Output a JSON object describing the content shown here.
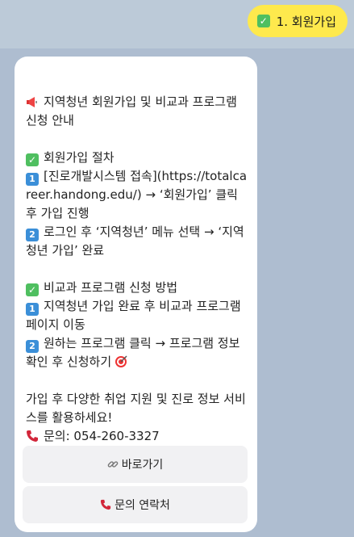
{
  "user_message": {
    "text": "1. 회원가입",
    "icon": "check-icon"
  },
  "bot_message": {
    "title": "지역청년 회원가입 및 비교과 프로그램 신청 안내",
    "signup_heading": "회원가입 절차",
    "signup_step_1": "[진로개발시스템 접속](https://totalcareer.handong.edu/) → ‘회원가입’ 클릭 후 가입 진행",
    "signup_step_2": "로그인 후 ‘지역청년’ 메뉴 선택 → ‘지역청년 가입’ 완료",
    "program_heading": "비교과 프로그램 신청 방법",
    "program_step_1": "지역청년 가입 완료 후 비교과 프로그램 페이지 이동",
    "program_step_2": "원하는 프로그램 클릭 → 프로그램 정보 확인 후 신청하기",
    "closing": "가입 후 다양한 취업 지원 및 진로 정보 서비스를 활용하세요!",
    "contact": "문의: 054-260-3327",
    "step_badges": [
      "1",
      "2"
    ]
  },
  "buttons": {
    "shortcut_label": "바로가기",
    "contact_label": "문의 연락처"
  },
  "colors": {
    "background": "#aebdd0",
    "user_bubble": "#fee94d",
    "card": "#ffffff",
    "button": "#f1f1f3",
    "check_green": "#4fbf60",
    "number_blue": "#3b8fd8"
  }
}
